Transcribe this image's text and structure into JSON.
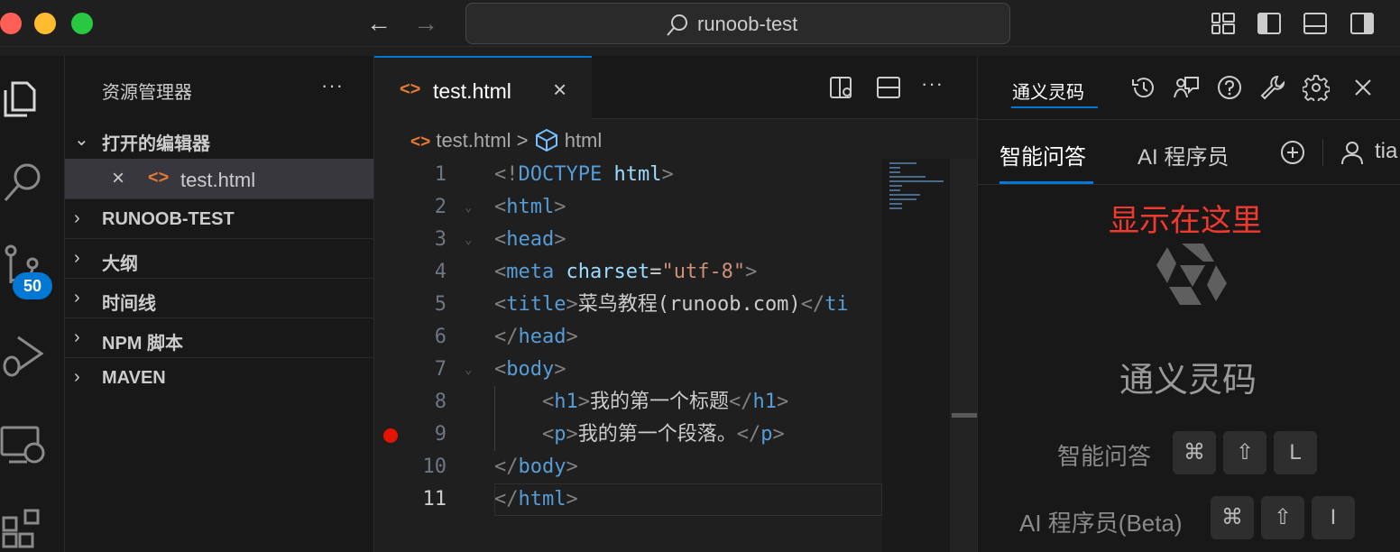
{
  "window": {
    "search_text": "runoob-test"
  },
  "activity_bar": {
    "scm_badge": "50"
  },
  "sidebar": {
    "title": "资源管理器",
    "more": "···",
    "sections": [
      {
        "label": "打开的编辑器",
        "expanded": true
      },
      {
        "label": "RUNOOB-TEST",
        "expanded": false
      },
      {
        "label": "大纲",
        "expanded": false
      },
      {
        "label": "时间线",
        "expanded": false
      },
      {
        "label": "NPM 脚本",
        "expanded": false
      },
      {
        "label": "MAVEN",
        "expanded": false
      }
    ],
    "open_editor": {
      "icon": "<>",
      "name": "test.html"
    }
  },
  "editor": {
    "tab": {
      "icon": "<>",
      "name": "test.html",
      "close": "×"
    },
    "more": "···",
    "breadcrumb": {
      "file": "test.html",
      "separator": ">",
      "symbol": "html"
    },
    "lines": [
      {
        "n": "1"
      },
      {
        "n": "2"
      },
      {
        "n": "3"
      },
      {
        "n": "4"
      },
      {
        "n": "5"
      },
      {
        "n": "6"
      },
      {
        "n": "7"
      },
      {
        "n": "8"
      },
      {
        "n": "9"
      },
      {
        "n": "10"
      },
      {
        "n": "11"
      }
    ],
    "code": {
      "l1_doctype": "<!DOCTYPE",
      "l1_html": " html",
      "l1_close": ">",
      "title_text": "菜鸟教程(runoob.com)",
      "h1_text": "我的第一个标题",
      "p_text": "我的第一个段落。",
      "charset_attr": "charset",
      "charset_val": "\"utf-8\"",
      "title_tail": "ti"
    },
    "breakpoint_line": "9",
    "active_line": "11"
  },
  "panel": {
    "tab_label": "通义灵码",
    "subtabs": [
      "智能问答",
      "AI 程序员"
    ],
    "user_label": "tia",
    "annotation": "显示在这里",
    "brand": "通义灵码",
    "shortcuts": [
      {
        "label": "智能问答",
        "keys": [
          "⌘",
          "⇧",
          "L"
        ]
      },
      {
        "label": "AI 程序员(Beta)",
        "keys": [
          "⌘",
          "⇧",
          "I"
        ]
      }
    ]
  }
}
